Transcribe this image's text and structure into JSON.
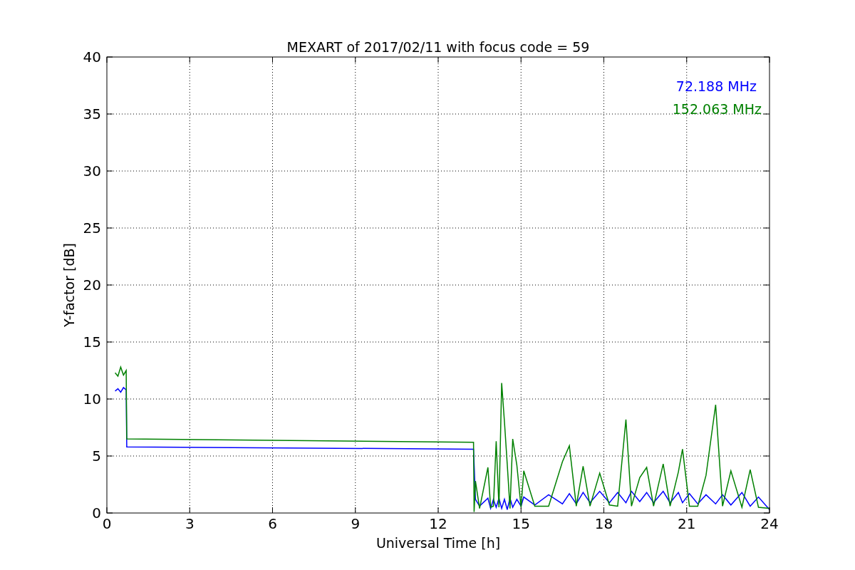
{
  "chart_data": {
    "type": "line",
    "title": "MEXART of 2017/02/11 with focus code = 59",
    "xlabel": "Universal Time [h]",
    "ylabel": "Y-factor [dB]",
    "xlim": [
      0,
      24
    ],
    "ylim": [
      0,
      40
    ],
    "xticks": [
      0,
      3,
      6,
      9,
      12,
      15,
      18,
      21,
      24
    ],
    "yticks": [
      0,
      5,
      10,
      15,
      20,
      25,
      30,
      35,
      40
    ],
    "grid": true,
    "x": [
      0.3,
      0.4,
      0.5,
      0.6,
      0.7,
      0.72,
      13.28,
      13.3,
      13.35,
      13.5,
      13.8,
      13.9,
      14.0,
      14.1,
      14.2,
      14.3,
      14.4,
      14.5,
      14.6,
      14.7,
      14.85,
      15.0,
      15.1,
      15.5,
      16.0,
      16.5,
      16.75,
      17.0,
      17.25,
      17.5,
      17.85,
      18.2,
      18.5,
      18.8,
      19.0,
      19.3,
      19.55,
      19.8,
      20.15,
      20.4,
      20.7,
      20.85,
      21.1,
      21.4,
      21.7,
      22.05,
      22.3,
      22.6,
      23.0,
      23.3,
      23.6,
      24.0
    ],
    "series": [
      {
        "name": "72.188 MHz",
        "color": "#0000ff",
        "values": [
          10.7,
          10.9,
          10.6,
          11.0,
          10.8,
          5.8,
          5.6,
          null,
          1.2,
          0.6,
          1.3,
          0.4,
          1.2,
          0.5,
          1.3,
          0.4,
          1.2,
          0.3,
          1.3,
          0.5,
          1.2,
          0.6,
          1.4,
          0.7,
          1.6,
          0.8,
          1.7,
          0.8,
          1.8,
          0.9,
          1.9,
          0.9,
          1.8,
          0.9,
          1.9,
          1.0,
          1.8,
          0.9,
          1.9,
          0.9,
          1.8,
          0.9,
          1.7,
          0.8,
          1.6,
          0.8,
          1.6,
          0.7,
          1.8,
          0.6,
          1.4,
          0.3
        ]
      },
      {
        "name": "152.063 MHz",
        "color": "#008000",
        "values": [
          12.3,
          12.0,
          12.8,
          12.1,
          12.5,
          6.5,
          6.2,
          0.1,
          2.8,
          0.4,
          4.0,
          0.5,
          0.6,
          6.3,
          0.5,
          11.4,
          8.0,
          4.3,
          0.4,
          6.5,
          4.2,
          0.5,
          3.7,
          0.6,
          0.6,
          4.5,
          5.9,
          0.6,
          4.1,
          0.6,
          3.5,
          0.7,
          0.6,
          8.2,
          0.6,
          3.1,
          4.0,
          0.6,
          4.3,
          0.6,
          3.6,
          5.6,
          0.6,
          0.6,
          3.3,
          9.5,
          0.6,
          3.7,
          0.5,
          3.8,
          0.5,
          0.4
        ]
      }
    ]
  }
}
